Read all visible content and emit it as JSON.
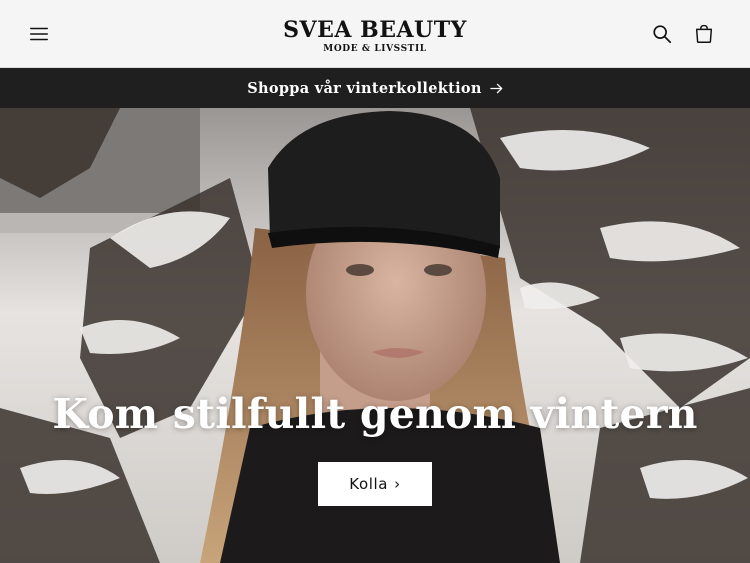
{
  "header": {
    "brand_name": "SVEA BEAUTY",
    "brand_tagline": "MODE & LIVSSTIL",
    "icons": {
      "menu": "hamburger-menu-icon",
      "search": "search-icon",
      "cart": "cart-icon"
    }
  },
  "announcement": {
    "text": "Shoppa vår vinterkollektion",
    "arrow": "→"
  },
  "hero": {
    "heading": "Kom stilfullt genom vintern",
    "button_label": "Kolla",
    "button_chevron": "›"
  },
  "colors": {
    "header_bg": "#f5f5f5",
    "announcement_bg": "#1f1f1f",
    "text_dark": "#121212",
    "button_bg": "#ffffff"
  }
}
